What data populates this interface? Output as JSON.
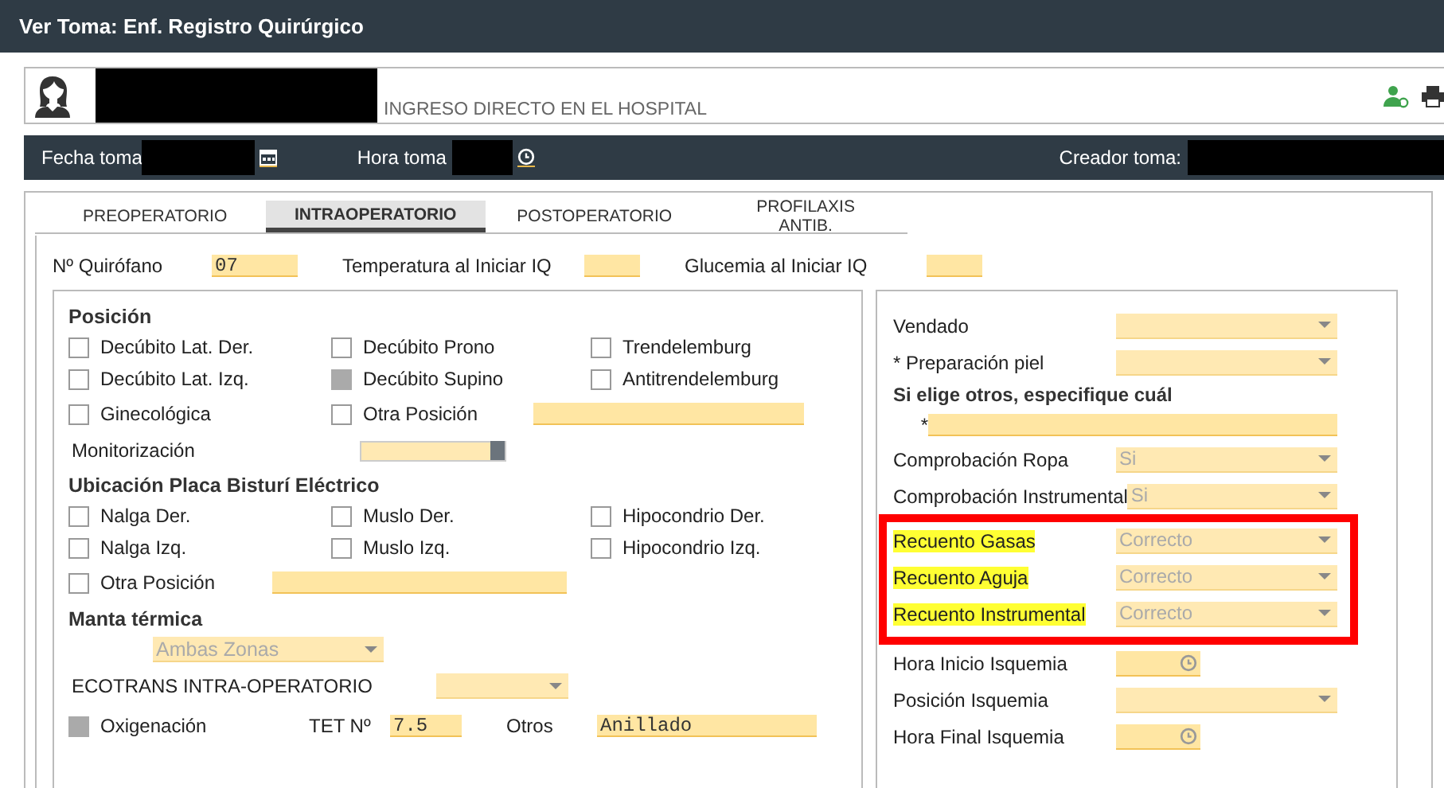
{
  "window": {
    "title": "Ver Toma: Enf. Registro Quirúrgico"
  },
  "patient": {
    "admission": "INGRESO DIRECTO EN EL HOSPITAL"
  },
  "toma_bar": {
    "date_label": "Fecha toma",
    "time_label": "Hora toma",
    "creator_label": "Creador toma:"
  },
  "tabs": [
    {
      "label": "PREOPERATORIO",
      "selected": false
    },
    {
      "label": "INTRAOPERATORIO",
      "selected": true
    },
    {
      "label": "POSTOPERATORIO",
      "selected": false
    },
    {
      "label": "PROFILAXIS ANTIB.",
      "selected": false
    }
  ],
  "top_fields": [
    {
      "label": "Nº Quirófano",
      "value": "07"
    },
    {
      "label": "Temperatura al Iniciar IQ"
    },
    {
      "label": "Glucemia al Iniciar IQ"
    }
  ],
  "left_items": [
    {
      "kind": "heading",
      "text": "Posición"
    },
    {
      "kind": "checks",
      "items": [
        {
          "label": "Decúbito Lat. Der.",
          "checked": false
        },
        {
          "label": "Decúbito Prono",
          "checked": false
        },
        {
          "label": "Trendelemburg",
          "checked": false
        }
      ]
    },
    {
      "kind": "checks",
      "items": [
        {
          "label": "Decúbito Lat. Izq.",
          "checked": false
        },
        {
          "label": "Decúbito Supino",
          "checked": true
        },
        {
          "label": "Antitrendelemburg",
          "checked": false
        }
      ]
    },
    {
      "kind": "checks_field",
      "items": [
        {
          "label": "Ginecológica",
          "checked": false
        },
        {
          "label": "Otra Posición",
          "checked": false
        }
      ]
    },
    {
      "kind": "list_field",
      "label": "Monitorización"
    },
    {
      "kind": "heading",
      "text": "Ubicación Placa Bisturí Eléctrico"
    },
    {
      "kind": "checks",
      "items": [
        {
          "label": "Nalga Der.",
          "checked": false
        },
        {
          "label": "Muslo Der.",
          "checked": false
        },
        {
          "label": "Hipocondrio Der.",
          "checked": false
        }
      ]
    },
    {
      "kind": "checks",
      "items": [
        {
          "label": "Nalga Izq.",
          "checked": false
        },
        {
          "label": "Muslo Izq.",
          "checked": false
        },
        {
          "label": "Hipocondrio Izq.",
          "checked": false
        }
      ]
    },
    {
      "kind": "check_field",
      "items": [
        {
          "label": "Otra Posición",
          "checked": false
        }
      ]
    },
    {
      "kind": "heading",
      "text": "Manta térmica"
    },
    {
      "kind": "select",
      "value": "Ambas Zonas"
    },
    {
      "kind": "label_select",
      "label": "ECOTRANS INTRA-OPERATORIO"
    },
    {
      "kind": "oxygen",
      "label": "Oxigenación",
      "checked": true,
      "tet_label": "TET Nº",
      "tet_value": "7.5",
      "other_label": "Otros",
      "other_value": "Anillado"
    }
  ],
  "right_items": [
    {
      "kind": "select",
      "label": "Vendado",
      "highlighted": false
    },
    {
      "kind": "select",
      "label": "* Preparación piel",
      "highlighted": false
    },
    {
      "kind": "heading",
      "text": "Si elige otros, especifique cuál"
    },
    {
      "kind": "star_field",
      "text": "*"
    },
    {
      "kind": "select",
      "label": "Comprobación Ropa",
      "value": "Si",
      "highlighted": false
    },
    {
      "kind": "select",
      "label": "Comprobación Instrumental",
      "value": "Si",
      "highlighted": false
    },
    {
      "kind": "select",
      "label": "Recuento Gasas",
      "value": "Correcto",
      "highlighted": true
    },
    {
      "kind": "select",
      "label": "Recuento Aguja",
      "value": "Correcto",
      "highlighted": true
    },
    {
      "kind": "select",
      "label": "Recuento Instrumental",
      "value": "Correcto",
      "highlighted": true
    },
    {
      "kind": "time",
      "label": "Hora Inicio Isquemia",
      "highlighted": false
    },
    {
      "kind": "select",
      "label": "Posición Isquemia",
      "highlighted": false
    },
    {
      "kind": "time",
      "label": "Hora Final Isquemia",
      "highlighted": false
    }
  ]
}
